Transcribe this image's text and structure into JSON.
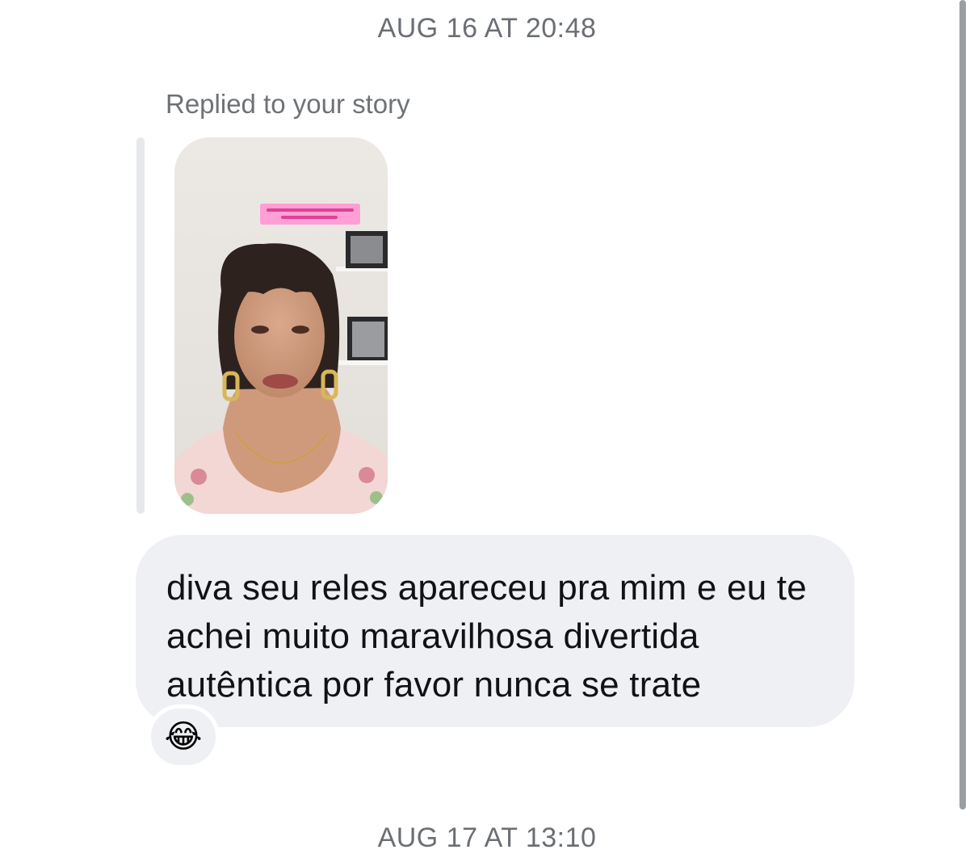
{
  "thread": {
    "timestamp_top": "AUG 16 AT 20:48",
    "reply_label": "Replied to your story",
    "story": {
      "overlay_text": "Silencio, a trad wife tá trabalhando",
      "image": "woman-portrait-selfie"
    },
    "message": {
      "text": "diva seu reles apareceu pra mim e eu te achei muito maravilhosa divertida autêntica por favor nunca se trate",
      "reaction": "😂",
      "bubble_color": "#eff0f3"
    },
    "timestamp_bottom": "AUG 17 AT 13:10"
  },
  "colors": {
    "background": "#ffffff",
    "meta_text": "#6b6f74",
    "reply_bar": "#e6e8eb",
    "story_caption_bg": "#ff9fd6"
  }
}
